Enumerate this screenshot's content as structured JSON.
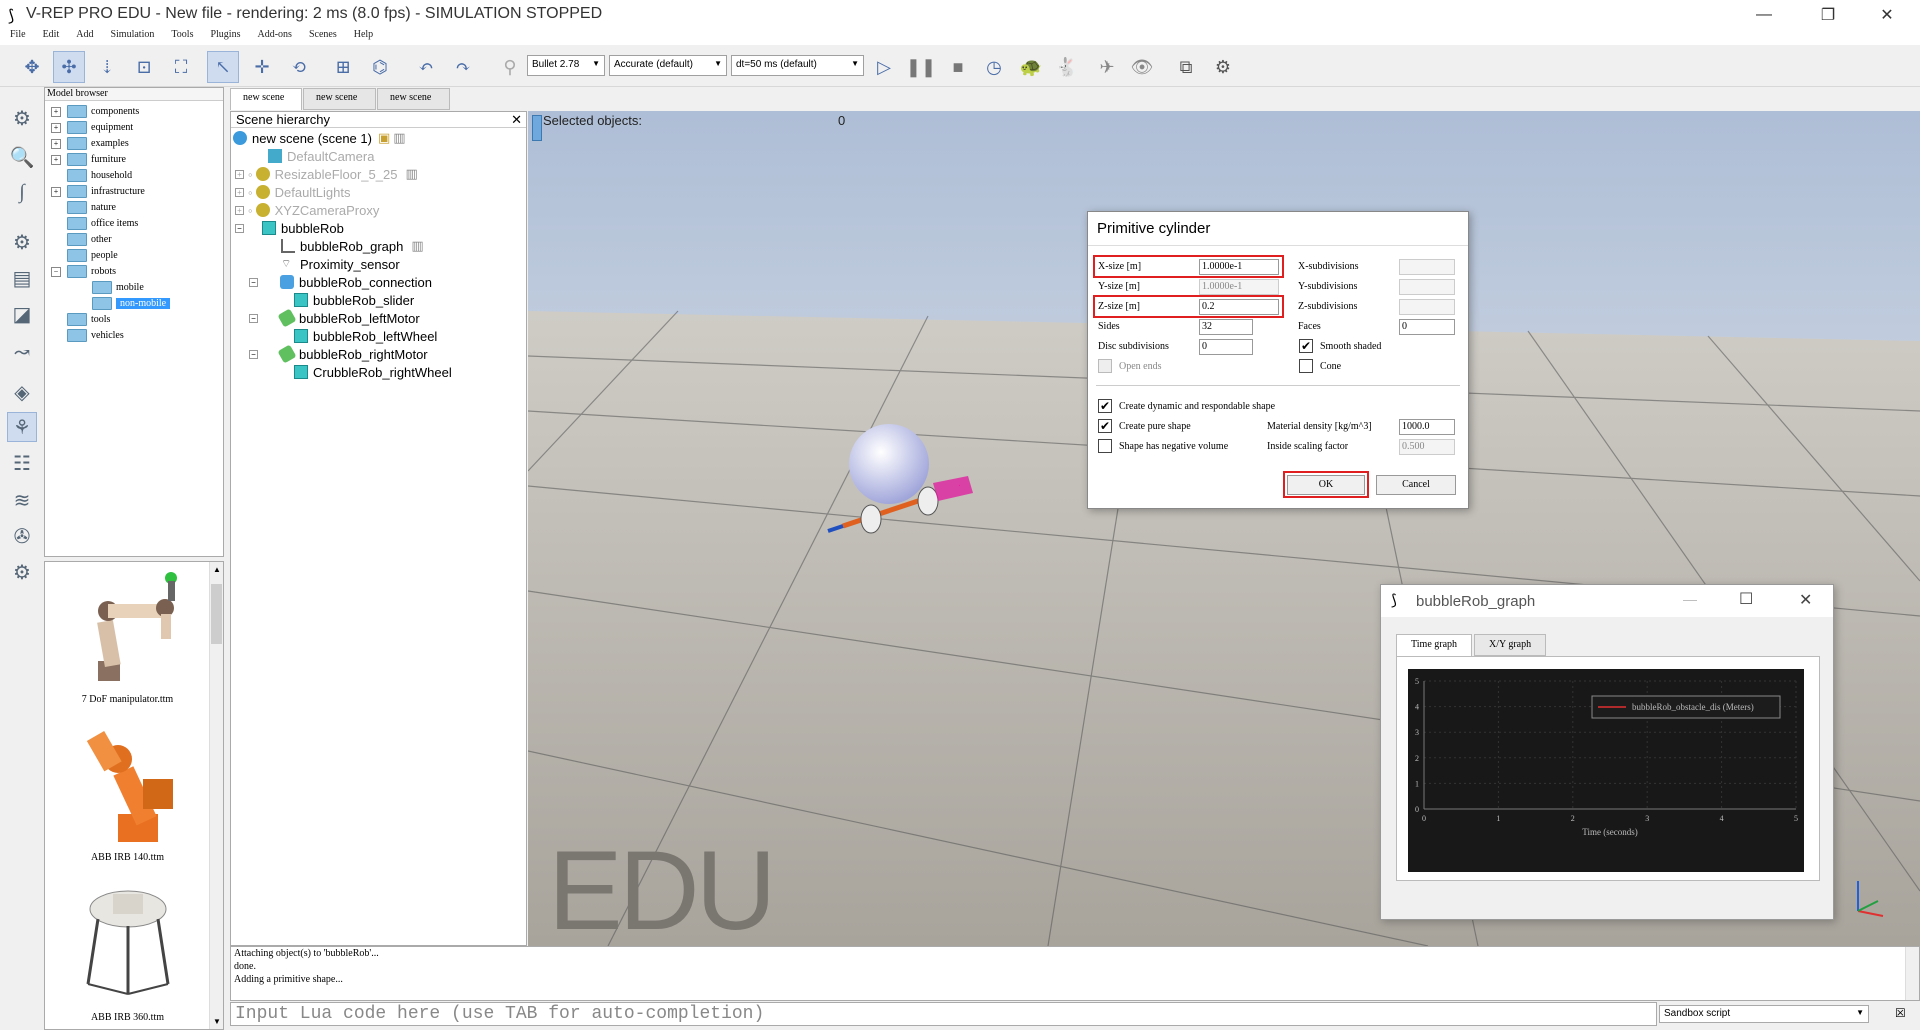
{
  "window": {
    "title": "V-REP PRO EDU - New file - rendering: 2 ms (8.0 fps) - SIMULATION STOPPED",
    "minimize": "—",
    "maximize": "❐",
    "close": "✕"
  },
  "menu": [
    "File",
    "Edit",
    "Add",
    "Simulation",
    "Tools",
    "Plugins",
    "Add-ons",
    "Scenes",
    "Help"
  ],
  "toolbar": {
    "engine": "Bullet 2.78",
    "accuracy": "Accurate (default)",
    "timestep": "dt=50 ms (default)"
  },
  "model_browser": {
    "header": "Model browser",
    "items": [
      "components",
      "equipment",
      "examples",
      "furniture",
      "household",
      "infrastructure",
      "nature",
      "office items",
      "other",
      "people",
      "robots",
      "mobile",
      "non-mobile",
      "tools",
      "vehicles"
    ],
    "thumbs": [
      "7 DoF manipulator.ttm",
      "ABB IRB 140.ttm",
      "ABB IRB 360.ttm"
    ]
  },
  "scene_tabs": [
    "new scene",
    "new scene",
    "new scene"
  ],
  "hierarchy": {
    "header": "Scene hierarchy",
    "items": [
      "new scene (scene 1)",
      "DefaultCamera",
      "ResizableFloor_5_25",
      "DefaultLights",
      "XYZCameraProxy",
      "bubbleRob",
      "bubbleRob_graph",
      "Proximity_sensor",
      "bubbleRob_connection",
      "bubbleRob_slider",
      "bubbleRob_leftMotor",
      "bubbleRob_leftWheel",
      "bubbleRob_rightMotor",
      "CrubbleRob_rightWheel"
    ]
  },
  "viewport": {
    "selected_label": "Selected objects:",
    "selected_count": "0",
    "watermark": "EDU"
  },
  "dialog": {
    "title": "Primitive cylinder",
    "xsize_label": "X-size [m]",
    "xsize_value": "1.0000e-1",
    "ysize_label": "Y-size [m]",
    "ysize_value": "1.0000e-1",
    "zsize_label": "Z-size [m]",
    "zsize_value": "0.2",
    "sides_label": "Sides",
    "sides_value": "32",
    "disc_label": "Disc subdivisions",
    "disc_value": "0",
    "openends_label": "Open ends",
    "xsub_label": "X-subdivisions",
    "ysub_label": "Y-subdivisions",
    "zsub_label": "Z-subdivisions",
    "faces_label": "Faces",
    "faces_value": "0",
    "smooth_label": "Smooth shaded",
    "cone_label": "Cone",
    "dynamic_label": "Create dynamic and respondable shape",
    "pure_label": "Create pure shape",
    "negvol_label": "Shape has negative volume",
    "density_label": "Material density [kg/m^3]",
    "density_value": "1000.0",
    "scaling_label": "Inside scaling factor",
    "scaling_value": "0.500",
    "ok": "OK",
    "cancel": "Cancel"
  },
  "graph_window": {
    "title": "bubbleRob_graph",
    "tabs": [
      "Time graph",
      "X/Y graph"
    ],
    "legend": "bubbleRob_obstacle_dis (Meters)",
    "xlabel": "Time (seconds)"
  },
  "chart_data": {
    "type": "line",
    "xlabel": "Time (seconds)",
    "ylabel": "",
    "x_ticks": [
      0,
      1,
      2,
      3,
      4,
      5
    ],
    "y_ticks": [
      0,
      1,
      2,
      3,
      4,
      5
    ],
    "xlim": [
      0,
      5
    ],
    "ylim": [
      0,
      5
    ],
    "grid": true,
    "legend_position": "top-right",
    "series": [
      {
        "name": "bubbleRob_obstacle_dis (Meters)",
        "color": "#e03030",
        "values": []
      }
    ]
  },
  "console": {
    "lines": [
      "Attaching object(s) to 'bubbleRob'...",
      "done.",
      "Adding a primitive shape..."
    ],
    "input_placeholder": "Input Lua code here (use TAB for auto-completion)",
    "script_selector": "Sandbox script"
  },
  "colors": {
    "highlight": "#e02020",
    "selection": "#3399ff",
    "graph_background": "#181818"
  }
}
